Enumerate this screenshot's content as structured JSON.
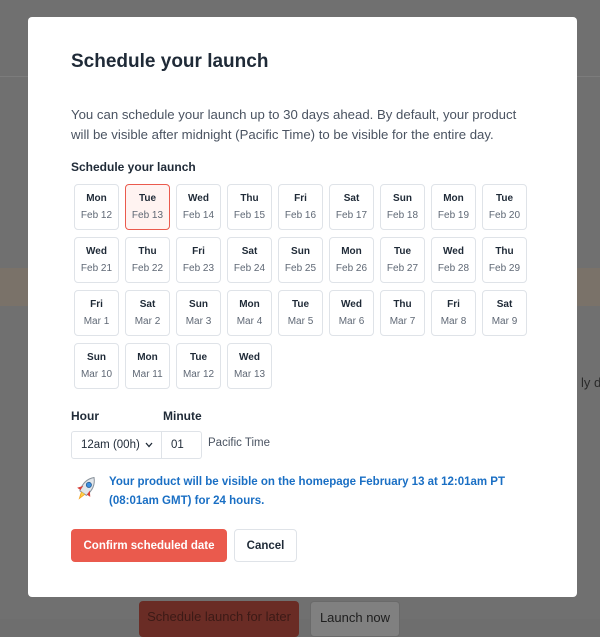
{
  "background": {
    "side_text": "ly d",
    "primary_button_label": "Schedule launch for later",
    "secondary_button_label": "Launch now"
  },
  "modal": {
    "title": "Schedule your launch",
    "description": "You can schedule your launch up to 30 days ahead. By default, your product will be visible after midnight (Pacific Time) to be visible for the entire day.",
    "section_label": "Schedule your launch",
    "selected_index": 1,
    "dates": [
      {
        "day": "Mon",
        "date": "Feb 12"
      },
      {
        "day": "Tue",
        "date": "Feb 13"
      },
      {
        "day": "Wed",
        "date": "Feb 14"
      },
      {
        "day": "Thu",
        "date": "Feb 15"
      },
      {
        "day": "Fri",
        "date": "Feb 16"
      },
      {
        "day": "Sat",
        "date": "Feb 17"
      },
      {
        "day": "Sun",
        "date": "Feb 18"
      },
      {
        "day": "Mon",
        "date": "Feb 19"
      },
      {
        "day": "Tue",
        "date": "Feb 20"
      },
      {
        "day": "Wed",
        "date": "Feb 21"
      },
      {
        "day": "Thu",
        "date": "Feb 22"
      },
      {
        "day": "Fri",
        "date": "Feb 23"
      },
      {
        "day": "Sat",
        "date": "Feb 24"
      },
      {
        "day": "Sun",
        "date": "Feb 25"
      },
      {
        "day": "Mon",
        "date": "Feb 26"
      },
      {
        "day": "Tue",
        "date": "Feb 27"
      },
      {
        "day": "Wed",
        "date": "Feb 28"
      },
      {
        "day": "Thu",
        "date": "Feb 29"
      },
      {
        "day": "Fri",
        "date": "Mar 1"
      },
      {
        "day": "Sat",
        "date": "Mar 2"
      },
      {
        "day": "Sun",
        "date": "Mar 3"
      },
      {
        "day": "Mon",
        "date": "Mar 4"
      },
      {
        "day": "Tue",
        "date": "Mar 5"
      },
      {
        "day": "Wed",
        "date": "Mar 6"
      },
      {
        "day": "Thu",
        "date": "Mar 7"
      },
      {
        "day": "Fri",
        "date": "Mar 8"
      },
      {
        "day": "Sat",
        "date": "Mar 9"
      },
      {
        "day": "Sun",
        "date": "Mar 10"
      },
      {
        "day": "Mon",
        "date": "Mar 11"
      },
      {
        "day": "Tue",
        "date": "Mar 12"
      },
      {
        "day": "Wed",
        "date": "Mar 13"
      }
    ],
    "hour_label": "Hour",
    "minute_label": "Minute",
    "hour_value": "12am (00h)",
    "minute_value": "01",
    "timezone": "Pacific Time",
    "info_icon": "rocket-icon",
    "info_text": "Your product will be visible on the homepage February 13 at 12:01am PT (08:01am GMT) for 24 hours.",
    "confirm_label": "Confirm scheduled date",
    "cancel_label": "Cancel"
  },
  "colors": {
    "accent": "#ea5a4d",
    "info_text": "#1a6fc4",
    "selected_fill": "#fff3f1",
    "overlay": "#707070"
  }
}
